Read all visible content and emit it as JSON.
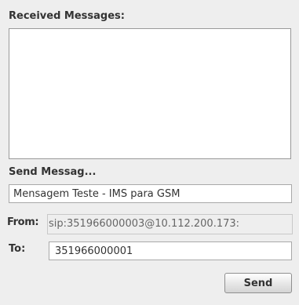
{
  "received": {
    "label": "Received Messages:"
  },
  "send": {
    "label": "Send Messag...",
    "message_value": "Mensagem Teste - IMS para GSM"
  },
  "from": {
    "label": "From:",
    "value": "sip:351966000003@10.112.200.173:"
  },
  "to": {
    "label": "To:",
    "value": "351966000001"
  },
  "actions": {
    "send_label": "Send"
  }
}
